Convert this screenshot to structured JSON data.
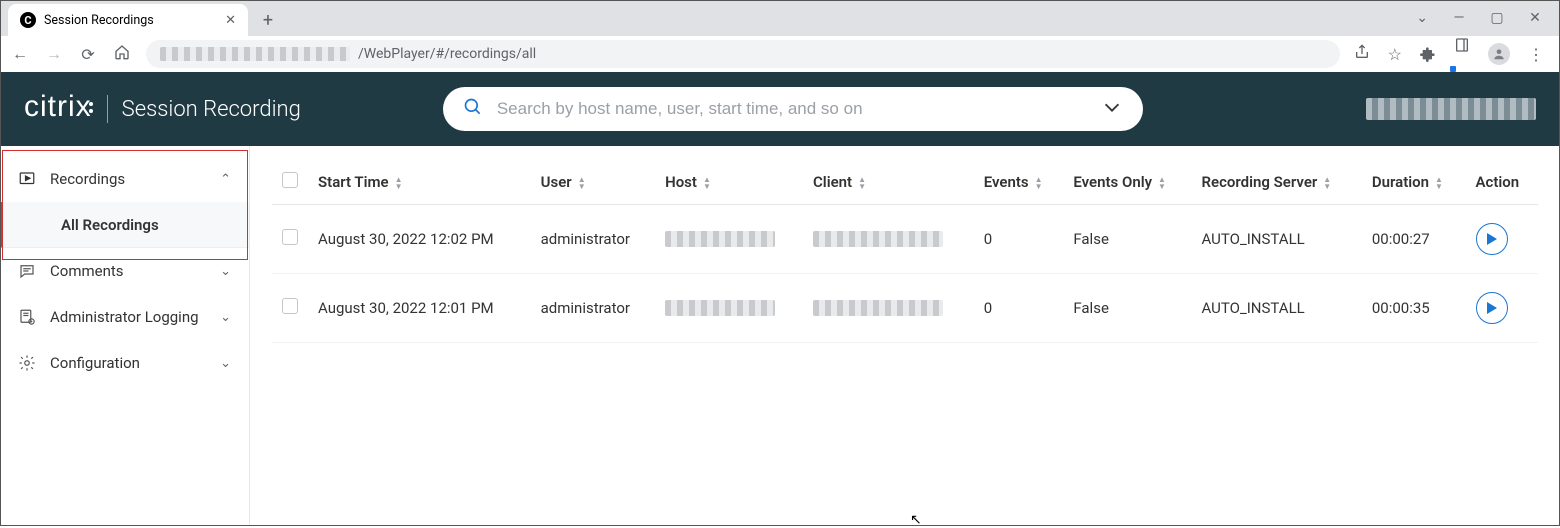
{
  "chrome": {
    "tab_title": "Session Recordings",
    "url_visible": "/WebPlayer/#/recordings/all"
  },
  "header": {
    "logo_text": "citrix",
    "app_title": "Session Recording",
    "search_placeholder": "Search by host name, user, start time, and so on"
  },
  "sidebar": {
    "recordings": "Recordings",
    "all_recordings": "All Recordings",
    "comments": "Comments",
    "admin_logging": "Administrator Logging",
    "configuration": "Configuration"
  },
  "table": {
    "cols": {
      "start_time": "Start Time",
      "user": "User",
      "host": "Host",
      "client": "Client",
      "events": "Events",
      "events_only": "Events Only",
      "recording_server": "Recording Server",
      "duration": "Duration",
      "action": "Action"
    },
    "rows": [
      {
        "start_time": "August 30, 2022 12:02 PM",
        "user": "administrator",
        "events": "0",
        "events_only": "False",
        "recording_server": "AUTO_INSTALL",
        "duration": "00:00:27"
      },
      {
        "start_time": "August 30, 2022 12:01 PM",
        "user": "administrator",
        "events": "0",
        "events_only": "False",
        "recording_server": "AUTO_INSTALL",
        "duration": "00:00:35"
      }
    ]
  }
}
